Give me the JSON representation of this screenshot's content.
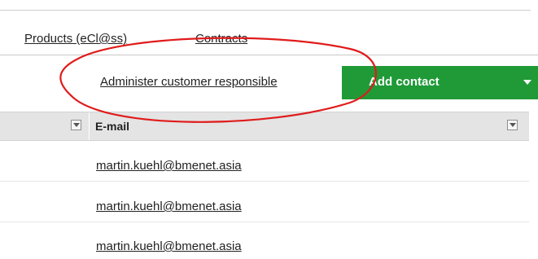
{
  "tabs": [
    {
      "label": "Products (eCl@ss)"
    },
    {
      "label": "Contracts"
    }
  ],
  "toolbar": {
    "administer_link": "Administer customer responsible",
    "add_contact_label": "Add contact"
  },
  "table": {
    "columns": [
      {
        "label": "E-mail"
      }
    ],
    "rows": [
      {
        "email": "martin.kuehl@bmenet.asia"
      },
      {
        "email": "martin.kuehl@bmenet.asia"
      },
      {
        "email": "martin.kuehl@bmenet.asia"
      }
    ]
  },
  "colors": {
    "add_contact_bg": "#1f9a37",
    "annotation": "#e01b1b",
    "header_bg": "#e4e4e4"
  },
  "icons": [
    "filter-dropdown-icon",
    "caret-down-icon"
  ]
}
